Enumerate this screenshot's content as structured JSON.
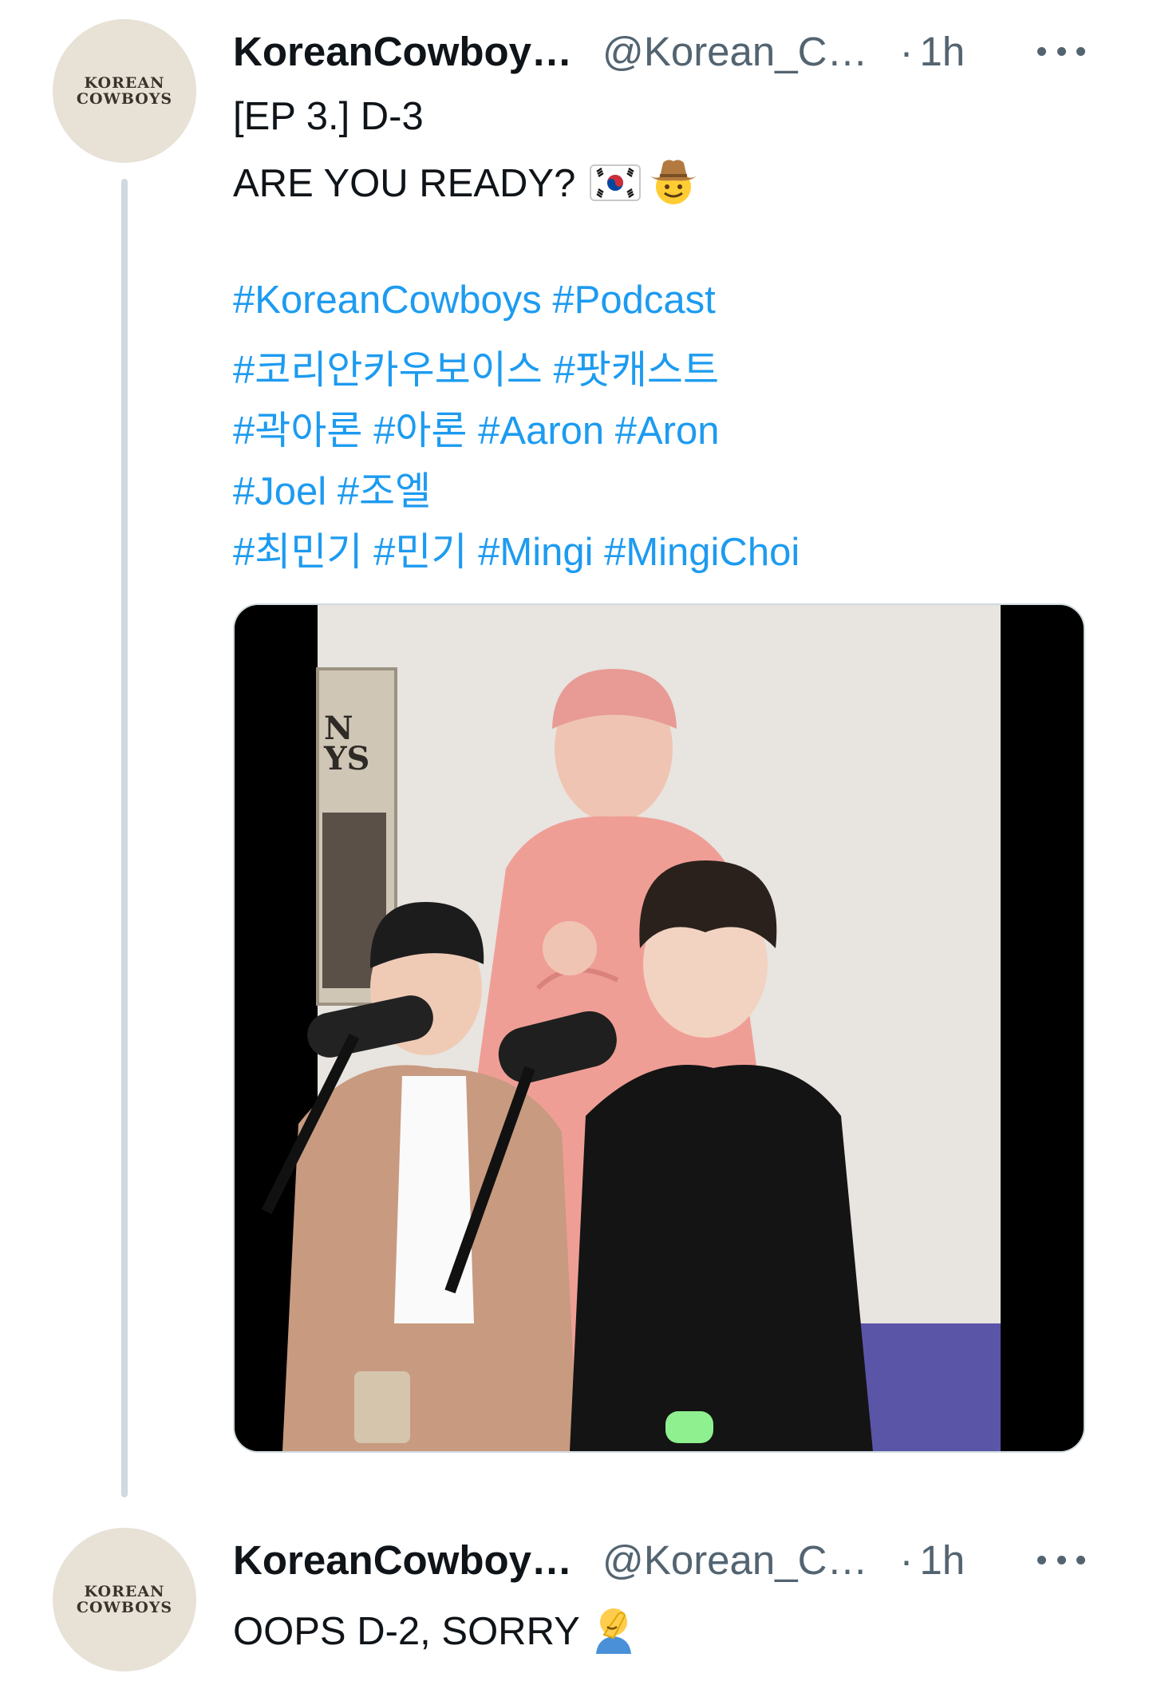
{
  "thread": [
    {
      "avatar_text": [
        "KOREAN",
        "COWBOYS"
      ],
      "display_name": "KoreanCowboy…",
      "handle": "@Korean_C…",
      "separator": "·",
      "time": "1h",
      "text_lines": [
        "[EP 3.] D-3",
        "ARE YOU READY?"
      ],
      "emojis": [
        "south-korea-flag-icon",
        "cowboy-face-icon"
      ],
      "hashtag_lines": [
        "#KoreanCowboys #Podcast",
        "#코리안카우보이스 #팟캐스트",
        "#곽아론 #아론 #Aaron #Aron",
        "#Joel #조엘",
        "#최민기 #민기 #Mingi #MingiChoi"
      ],
      "media": {
        "type": "video-thumbnail",
        "poster_text": [
          "N",
          "YS"
        ]
      }
    },
    {
      "avatar_text": [
        "KOREAN",
        "COWBOYS"
      ],
      "display_name": "KoreanCowboy…",
      "handle": "@Korean_C…",
      "separator": "·",
      "time": "1h",
      "text": "OOPS D-2, SORRY",
      "emojis": [
        "facepalm-icon"
      ]
    }
  ],
  "colors": {
    "link": "#1d9bf0",
    "text": "#0f1419",
    "secondary": "#536471",
    "thread_line": "#cfd9de",
    "avatar_bg": "#e7e1d6"
  }
}
